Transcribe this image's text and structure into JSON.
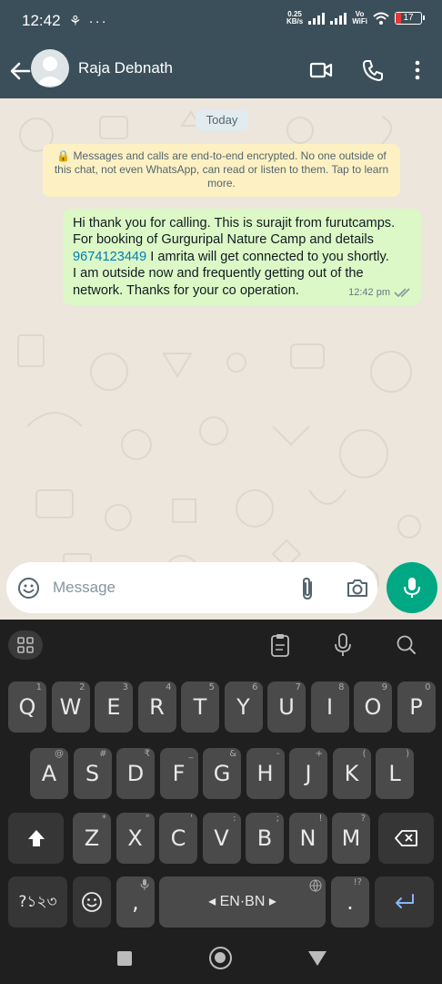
{
  "status_bar": {
    "time": "12:42",
    "left_icons": "⚘ ···",
    "net_speed": "0.25",
    "net_unit": "KB/s",
    "vo": "Vo",
    "wifi_label": "WiFi",
    "battery": "17"
  },
  "header": {
    "contact_name": "Raja Debnath"
  },
  "chat": {
    "date_chip": "Today",
    "encryption_notice": "🔒 Messages and calls are end-to-end encrypted. No one outside of this chat, not even WhatsApp, can read or listen to them. Tap to learn more.",
    "message": {
      "line1": "Hi thank you for calling. This is surajit from furutcamps.",
      "line2": "For booking of Gurguripal Nature Camp and details",
      "phone": "9674123449",
      "line3_rest": " I amrita will get connected to you shortly.",
      "line4": "I am outside now and frequently getting out of the",
      "line5": "network. Thanks for your co operation.",
      "time": "12:42 pm",
      "status": "read"
    }
  },
  "input": {
    "placeholder": "Message"
  },
  "keyboard": {
    "row1": [
      {
        "k": "Q",
        "h": "1"
      },
      {
        "k": "W",
        "h": "2"
      },
      {
        "k": "E",
        "h": "3"
      },
      {
        "k": "R",
        "h": "4"
      },
      {
        "k": "T",
        "h": "5"
      },
      {
        "k": "Y",
        "h": "6"
      },
      {
        "k": "U",
        "h": "7"
      },
      {
        "k": "I",
        "h": "8"
      },
      {
        "k": "O",
        "h": "9"
      },
      {
        "k": "P",
        "h": "0"
      }
    ],
    "row2": [
      {
        "k": "A",
        "h": "@"
      },
      {
        "k": "S",
        "h": "#"
      },
      {
        "k": "D",
        "h": "₹"
      },
      {
        "k": "F",
        "h": "_"
      },
      {
        "k": "G",
        "h": "&"
      },
      {
        "k": "H",
        "h": "-"
      },
      {
        "k": "J",
        "h": "+"
      },
      {
        "k": "K",
        "h": "("
      },
      {
        "k": "L",
        "h": ")"
      }
    ],
    "row3": [
      {
        "k": "Z",
        "h": "*"
      },
      {
        "k": "X",
        "h": "\""
      },
      {
        "k": "C",
        "h": "'"
      },
      {
        "k": "V",
        "h": ":"
      },
      {
        "k": "B",
        "h": ";"
      },
      {
        "k": "N",
        "h": "!"
      },
      {
        "k": "M",
        "h": "?"
      }
    ],
    "symbols_key": "?১২৩",
    "comma": ",",
    "space_label": "◂ EN·BN ▸",
    "period": ".",
    "period_hint": "!?"
  },
  "colors": {
    "header": "#3b4f5a",
    "accent": "#00a884",
    "bubble": "#dcf8c6",
    "link": "#027eb5"
  }
}
